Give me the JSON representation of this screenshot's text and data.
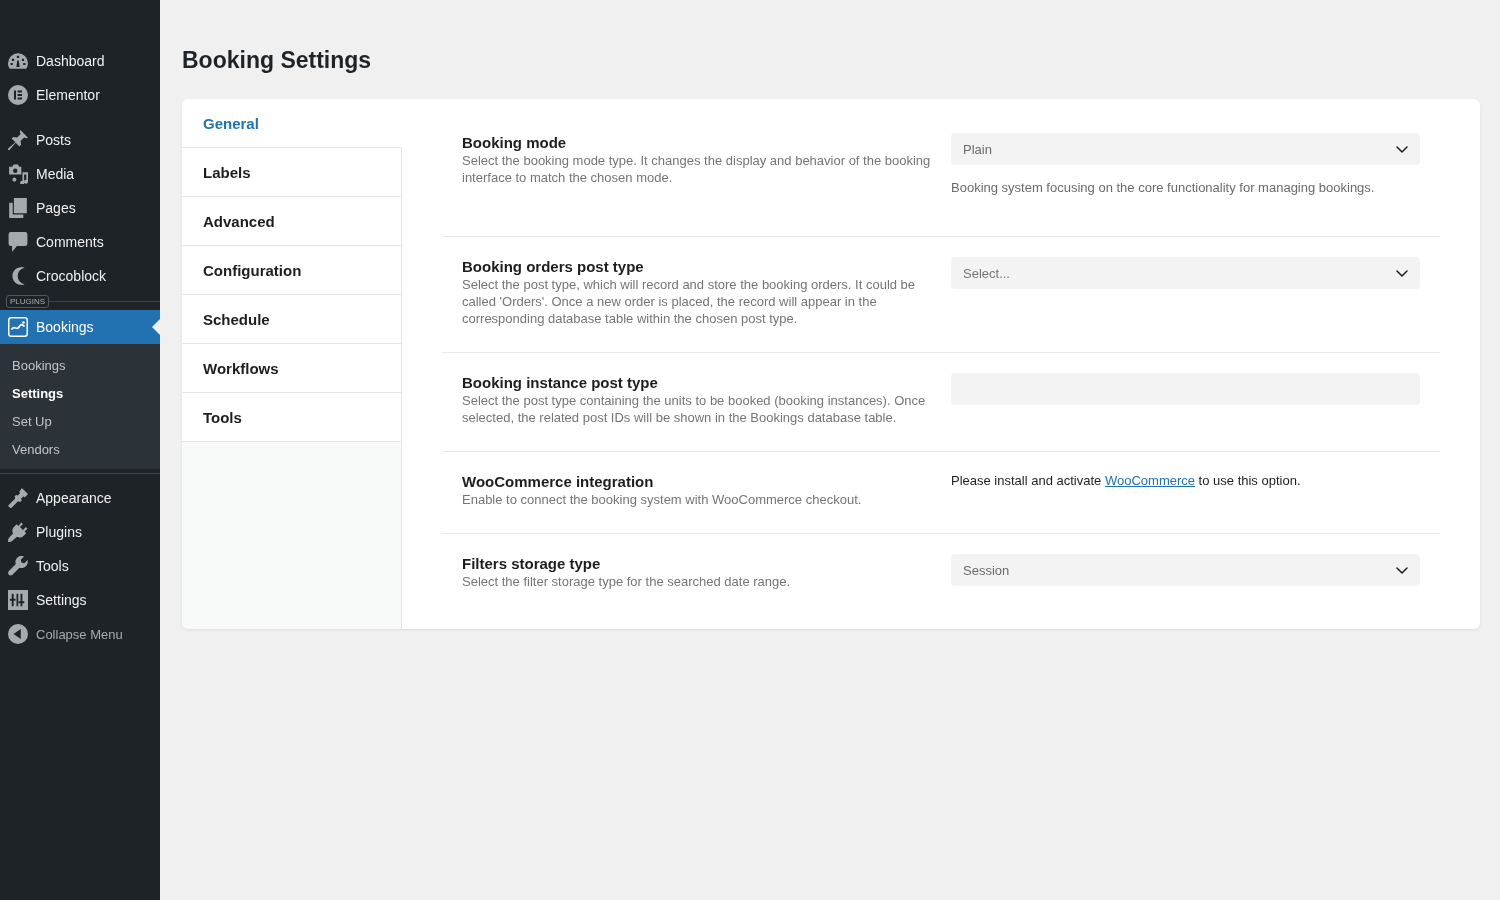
{
  "sidebar": {
    "groups": [
      {
        "items": [
          {
            "label": "Dashboard",
            "selected": false
          },
          {
            "label": "Elementor",
            "selected": false
          }
        ]
      },
      {
        "items": [
          {
            "label": "Posts",
            "selected": false
          },
          {
            "label": "Media",
            "selected": false
          },
          {
            "label": "Pages",
            "selected": false
          },
          {
            "label": "Comments",
            "selected": false
          },
          {
            "label": "Crocoblock",
            "selected": false
          }
        ]
      },
      {
        "section_label": "PLUGINS",
        "items": [
          {
            "label": "Bookings",
            "selected": true,
            "submenu": [
              {
                "label": "Bookings",
                "selected": false
              },
              {
                "label": "Settings",
                "selected": true
              },
              {
                "label": "Set Up",
                "selected": false
              },
              {
                "label": "Vendors",
                "selected": false
              }
            ]
          }
        ]
      },
      {
        "items": [
          {
            "label": "Appearance",
            "selected": false
          },
          {
            "label": "Plugins",
            "selected": false
          },
          {
            "label": "Tools",
            "selected": false
          },
          {
            "label": "Settings",
            "selected": false
          }
        ]
      }
    ],
    "collapse_label": "Collapse Menu"
  },
  "page_title": "Booking Settings",
  "tabs": [
    {
      "label": "General",
      "selected": true
    },
    {
      "label": "Labels",
      "selected": false
    },
    {
      "label": "Advanced",
      "selected": false
    },
    {
      "label": "Configuration",
      "selected": false
    },
    {
      "label": "Schedule",
      "selected": false
    },
    {
      "label": "Workflows",
      "selected": false
    },
    {
      "label": "Tools",
      "selected": false
    }
  ],
  "settings": [
    {
      "label": "Booking mode",
      "description": "Select the booking mode type. It changes the display and behavior of the booking interface to match the chosen mode.",
      "field": {
        "kind": "select",
        "value": "Plain",
        "help": "Booking system focusing on the core functionality for managing bookings."
      }
    },
    {
      "label": "Booking orders post type",
      "description": "Select the post type, which will record and store the booking orders. It could be called 'Orders'. Once a new order is placed, the record will appear in the corresponding database table within the chosen post type.",
      "field": {
        "kind": "select",
        "placeholder": "Select..."
      }
    },
    {
      "label": "Booking instance post type",
      "description": "Select the post type containing the units to be booked (booking instances). Once selected, the related post IDs will be shown in the Bookings database table.",
      "field": {
        "kind": "input"
      }
    },
    {
      "label": "WooCommerce integration",
      "description": "Enable to connect the booking system with WooCommerce checkout.",
      "field": {
        "kind": "notice",
        "text_before": "Please install and activate ",
        "link": "WooCommerce",
        "text_after": " to use this option."
      }
    },
    {
      "label": "Filters storage type",
      "description": "Select the filter storage type for the searched date range.",
      "field": {
        "kind": "select",
        "value": "Session"
      }
    }
  ]
}
